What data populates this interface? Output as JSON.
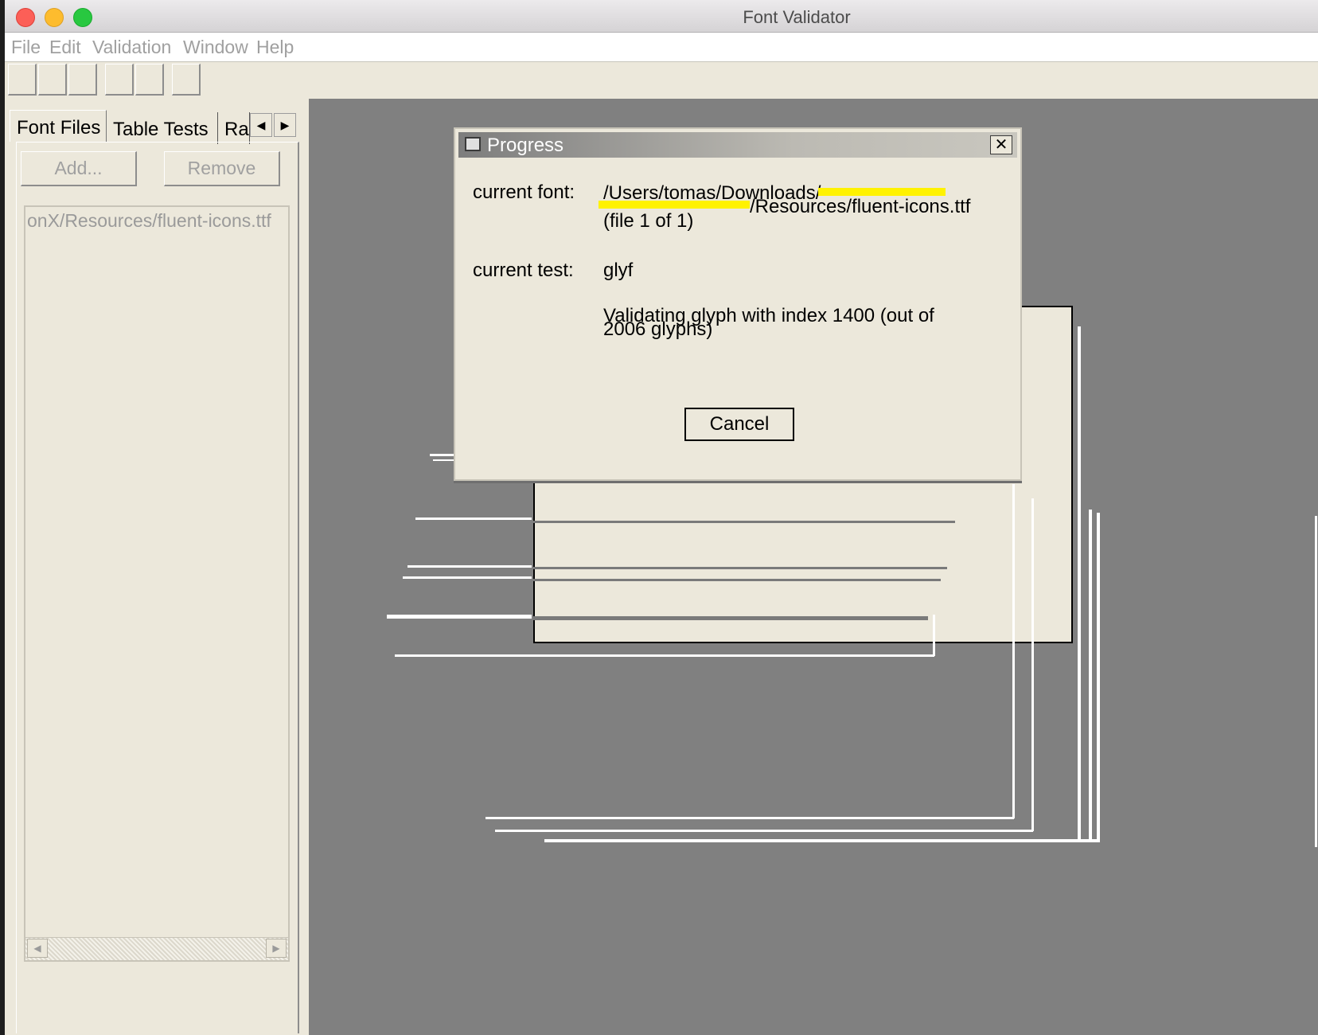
{
  "window": {
    "title": "Font Validator"
  },
  "menu": [
    "File",
    "Edit",
    "Validation",
    "Window",
    "Help"
  ],
  "tabs": [
    "Font Files",
    "Table Tests",
    "Ra"
  ],
  "file_panel": {
    "add_label": "Add...",
    "remove_label": "Remove",
    "files": [
      "onX/Resources/fluent-icons.ttf"
    ]
  },
  "progress_dialog": {
    "title": "Progress",
    "current_font_label": "current font:",
    "current_font_line1": "/Users/tomas/Downloads/",
    "current_font_line2": "/Resources/fluent-icons.ttf",
    "current_font_line3": "(file 1 of 1)",
    "current_test_label": "current test:",
    "current_test_value": "glyf",
    "status_line1": "Validating glyph with index 1400 (out of",
    "status_line2": "2006 glyphs)",
    "cancel_label": "Cancel",
    "redaction_color": "#fff200"
  }
}
